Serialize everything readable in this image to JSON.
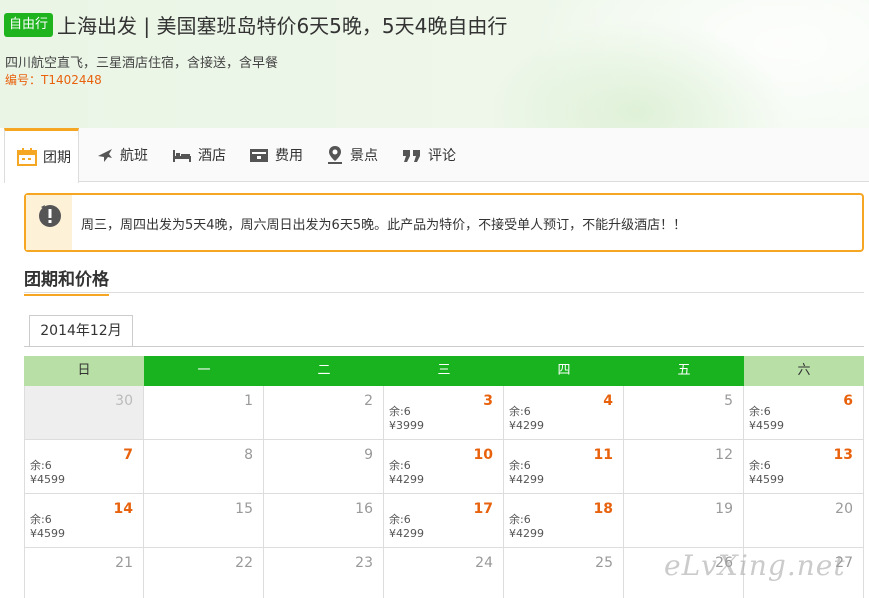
{
  "header": {
    "tag": "自由行",
    "title": "上海出发 | 美国塞班岛特价6天5晚，5天4晚自由行",
    "subtitle": "四川航空直飞，三星酒店住宿，含接送，含早餐",
    "code": "编号：T1402448"
  },
  "tabs": [
    {
      "label": "团期",
      "icon": "calendar-icon"
    },
    {
      "label": "航班",
      "icon": "plane-icon"
    },
    {
      "label": "酒店",
      "icon": "bed-icon"
    },
    {
      "label": "费用",
      "icon": "wallet-icon"
    },
    {
      "label": "景点",
      "icon": "location-pin-icon"
    },
    {
      "label": "评论",
      "icon": "quote-icon"
    }
  ],
  "notice": {
    "text": "周三，周四出发为5天4晚，周六周日出发为6天5晚。此产品为特价，不接受单人预订，不能升级酒店！！"
  },
  "section": {
    "title": "团期和价格"
  },
  "calendar": {
    "month": "2014年12月",
    "weekdays": [
      "日",
      "一",
      "二",
      "三",
      "四",
      "五",
      "六"
    ],
    "rows": [
      [
        {
          "day": "30",
          "past": true
        },
        {
          "day": "1"
        },
        {
          "day": "2"
        },
        {
          "day": "3",
          "remain": "余:6",
          "price": "¥3999"
        },
        {
          "day": "4",
          "remain": "余:6",
          "price": "¥4299"
        },
        {
          "day": "5"
        },
        {
          "day": "6",
          "remain": "余:6",
          "price": "¥4599"
        }
      ],
      [
        {
          "day": "7",
          "remain": "余:6",
          "price": "¥4599"
        },
        {
          "day": "8"
        },
        {
          "day": "9"
        },
        {
          "day": "10",
          "remain": "余:6",
          "price": "¥4299"
        },
        {
          "day": "11",
          "remain": "余:6",
          "price": "¥4299"
        },
        {
          "day": "12"
        },
        {
          "day": "13",
          "remain": "余:6",
          "price": "¥4599"
        }
      ],
      [
        {
          "day": "14",
          "remain": "余:6",
          "price": "¥4599"
        },
        {
          "day": "15"
        },
        {
          "day": "16"
        },
        {
          "day": "17",
          "remain": "余:6",
          "price": "¥4299"
        },
        {
          "day": "18",
          "remain": "余:6",
          "price": "¥4299"
        },
        {
          "day": "19"
        },
        {
          "day": "20"
        }
      ],
      [
        {
          "day": "21"
        },
        {
          "day": "22"
        },
        {
          "day": "23"
        },
        {
          "day": "24"
        },
        {
          "day": "25"
        },
        {
          "day": "26"
        },
        {
          "day": "27"
        }
      ]
    ]
  },
  "watermark": "eLvXing.net",
  "colors": {
    "accent": "#f5a623",
    "green": "#19b320",
    "price": "#e8620e"
  }
}
